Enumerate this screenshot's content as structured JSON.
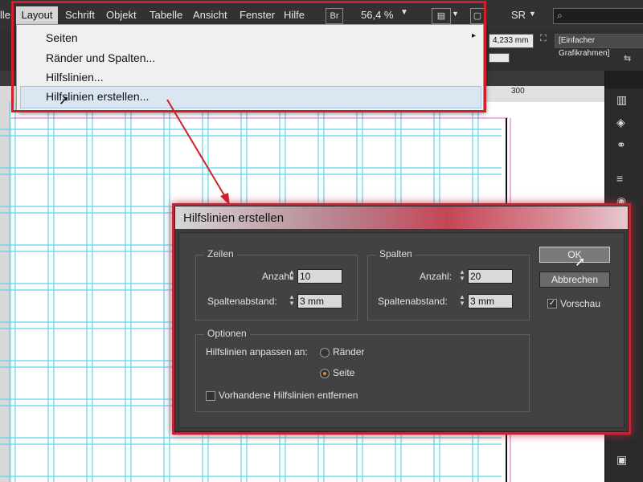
{
  "menubar": {
    "partial_left": "lle",
    "items": [
      "Layout",
      "Schrift",
      "Objekt",
      "Tabelle",
      "Ansicht",
      "Fenster",
      "Hilfe"
    ],
    "br_badge": "Br",
    "zoom": "56,4 %",
    "workspace": "SR"
  },
  "controlbar": {
    "field_value": "4,233 mm",
    "frame_style": "[Einfacher Grafikrahmen]",
    "ruler_label": "300"
  },
  "dropdown": {
    "items": [
      "Seiten",
      "Ränder und Spalten...",
      "Hilfslinien...",
      "Hilfslinien erstellen..."
    ],
    "submenu_arrow": "▸"
  },
  "dialog": {
    "title": "Hilfslinien erstellen",
    "rows": {
      "title": "Zeilen",
      "count_label": "Anzahl:",
      "count_value": "10",
      "gutter_label": "Spaltenabstand:",
      "gutter_value": "3 mm"
    },
    "columns": {
      "title": "Spalten",
      "count_label": "Anzahl:",
      "count_value": "20",
      "gutter_label": "Spaltenabstand:",
      "gutter_value": "3 mm"
    },
    "options": {
      "title": "Optionen",
      "fit_label": "Hilfslinien anpassen an:",
      "fit_margins": "Ränder",
      "fit_page": "Seite",
      "fit_selected": "Seite",
      "remove_existing": "Vorhandene Hilfslinien entfernen",
      "remove_existing_checked": false
    },
    "ok_label": "OK",
    "cancel_label": "Abbrechen",
    "preview_label": "Vorschau",
    "preview_checked": true
  },
  "colors": {
    "guide_cyan": "#5ad8e6",
    "highlight_red": "#d0202a",
    "margin_magenta": "#e060c8"
  }
}
